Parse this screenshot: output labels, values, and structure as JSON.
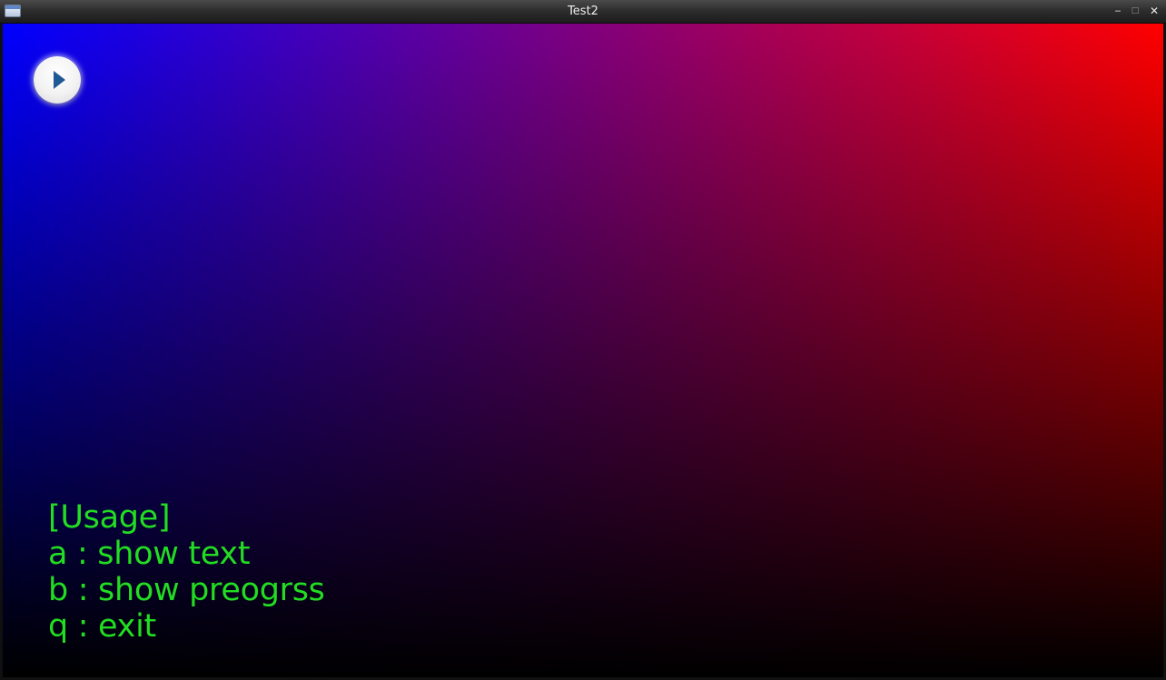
{
  "window": {
    "title": "Test2",
    "controls": {
      "minimize": "‒",
      "maximize": "□",
      "close": "✕"
    }
  },
  "icons": {
    "app": "app-window-icon",
    "play": "play-icon"
  },
  "colors": {
    "gradient_left": "#0000ff",
    "gradient_right": "#ff0000",
    "gradient_bottom": "#000000",
    "usage_text": "#22dd22",
    "play_arrow": "#1f5a96"
  },
  "usage": {
    "heading": "[Usage]",
    "lines": [
      "a : show text",
      "b : show preogrss",
      "q : exit"
    ]
  }
}
